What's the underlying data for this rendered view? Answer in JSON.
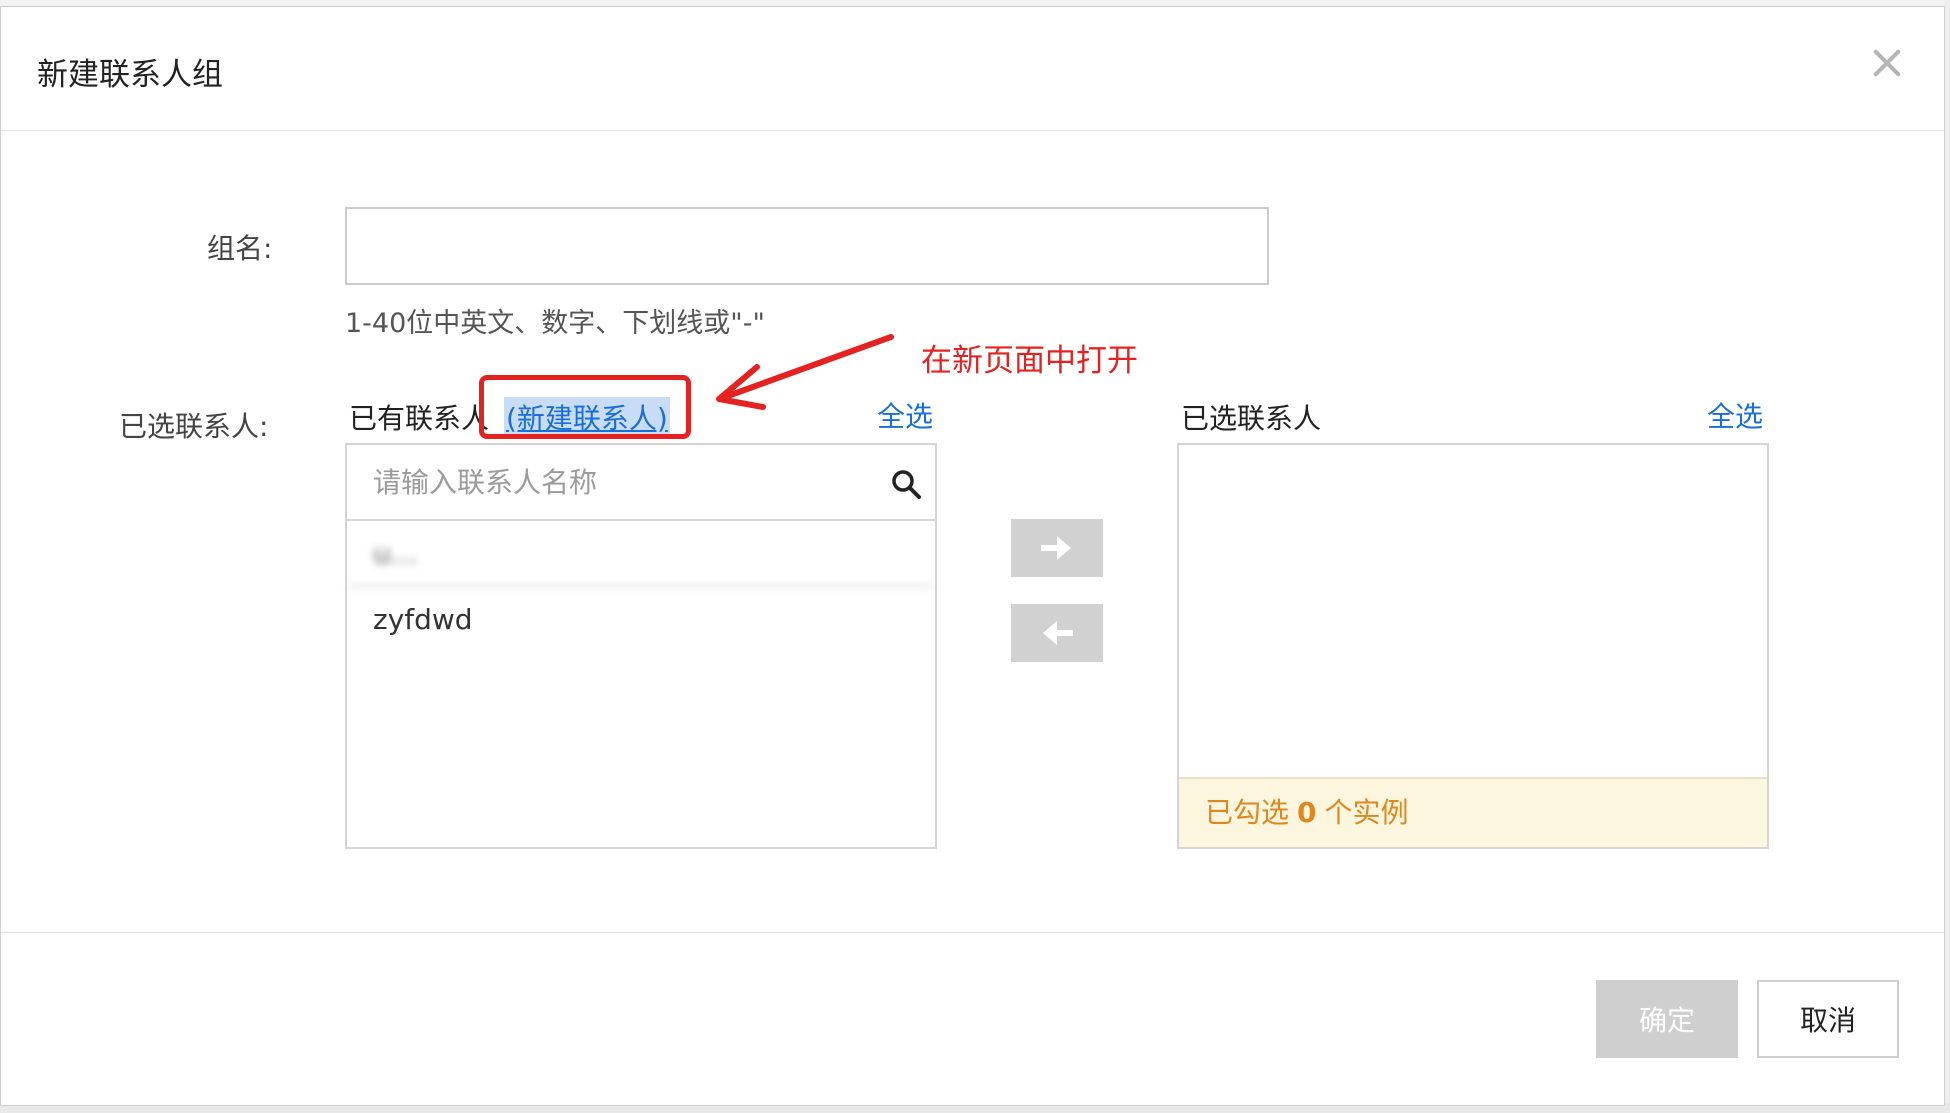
{
  "dialog": {
    "title": "新建联系人组"
  },
  "form": {
    "group_name_label": "组名:",
    "group_name_value": "",
    "group_name_hint": "1-40位中英文、数字、下划线或\"-\"",
    "contacts_label": "已选联系人:"
  },
  "left_panel": {
    "title": "已有联系人",
    "new_contact_link": "(新建联系人)",
    "select_all": "全选",
    "search_placeholder": "请输入联系人名称",
    "items": [
      "u…",
      "zyfdwd"
    ]
  },
  "right_panel": {
    "title": "已选联系人",
    "select_all": "全选",
    "footer_prefix": "已勾选",
    "selected_count": "0",
    "footer_suffix": "个实例"
  },
  "annotation": {
    "text": "在新页面中打开",
    "color": "#e52222"
  },
  "footer": {
    "confirm_label": "确定",
    "cancel_label": "取消"
  },
  "colors": {
    "link": "#1a6ed8",
    "warning_text": "#e0871f",
    "warning_bg": "#fdf6de"
  }
}
